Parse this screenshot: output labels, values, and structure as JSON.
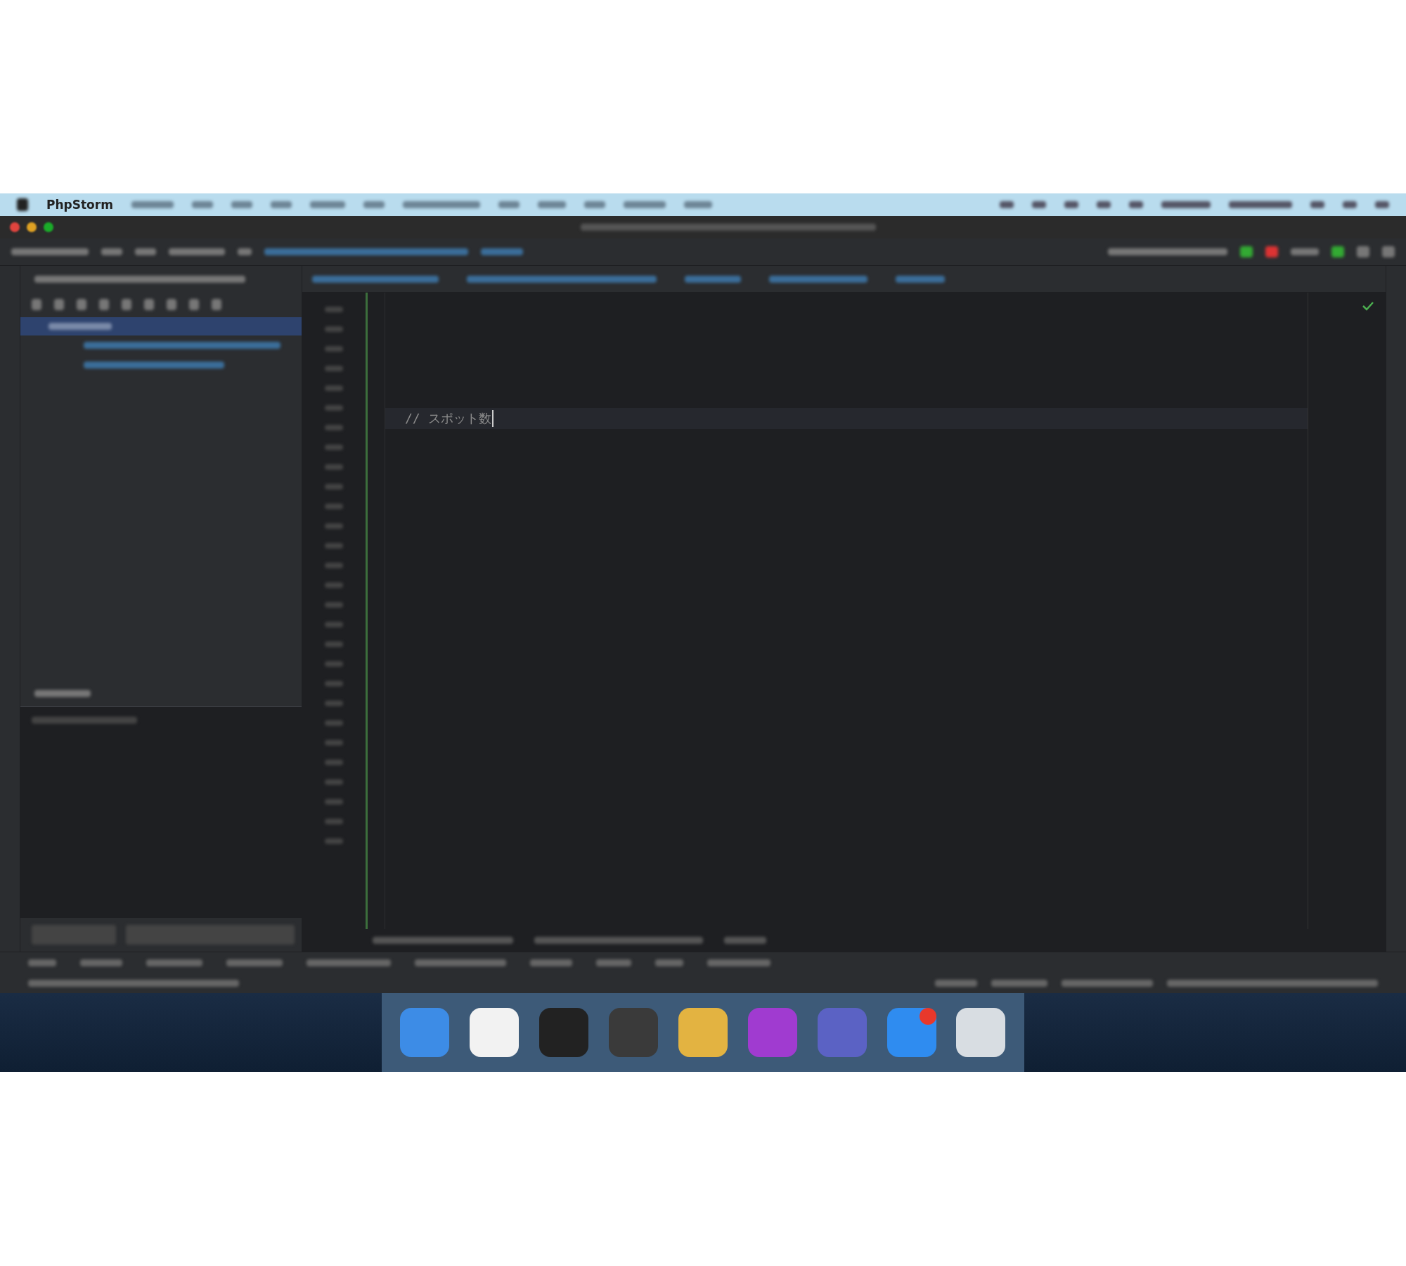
{
  "menu_bar": {
    "app_name": "PhpStorm"
  },
  "editor": {
    "code_line": "// スポット数"
  },
  "dock": {
    "apps": [
      {
        "kind": "finder",
        "badge": false
      },
      {
        "kind": "slack",
        "badge": false
      },
      {
        "kind": "terminal",
        "badge": false
      },
      {
        "kind": "sublime",
        "badge": false
      },
      {
        "kind": "chrome",
        "badge": false
      },
      {
        "kind": "phpstorm",
        "badge": false
      },
      {
        "kind": "teams",
        "badge": false
      },
      {
        "kind": "appstore",
        "badge": true
      },
      {
        "kind": "trash",
        "badge": false
      }
    ]
  }
}
